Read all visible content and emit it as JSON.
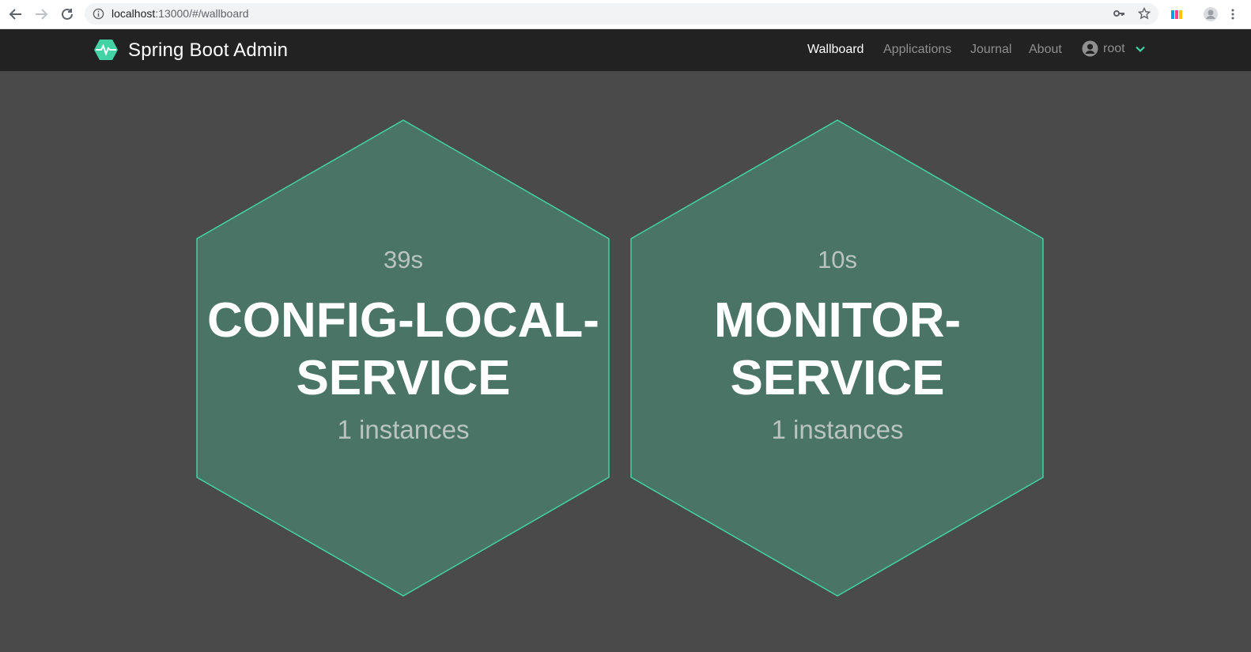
{
  "browser": {
    "url_host": "localhost",
    "url_path": ":13000/#/wallboard"
  },
  "navbar": {
    "brand": "Spring Boot Admin",
    "items": [
      {
        "label": "Wallboard",
        "active": true
      },
      {
        "label": "Applications",
        "active": false
      },
      {
        "label": "Journal",
        "active": false
      },
      {
        "label": "About",
        "active": false
      }
    ],
    "user": "root"
  },
  "wallboard": {
    "apps": [
      {
        "time": "39s",
        "name_line1": "CONFIG-LOCAL-",
        "name_line2": "SERVICE",
        "instances": "1 instances"
      },
      {
        "time": "10s",
        "name_line1": "MONITOR-",
        "name_line2": "SERVICE",
        "instances": "1 instances"
      }
    ]
  },
  "colors": {
    "hex_fill": "#4a7566",
    "hex_stroke": "#42d3a5",
    "navbar_bg": "#222222",
    "page_bg": "#4a4a4a",
    "accent": "#42d3a5"
  }
}
